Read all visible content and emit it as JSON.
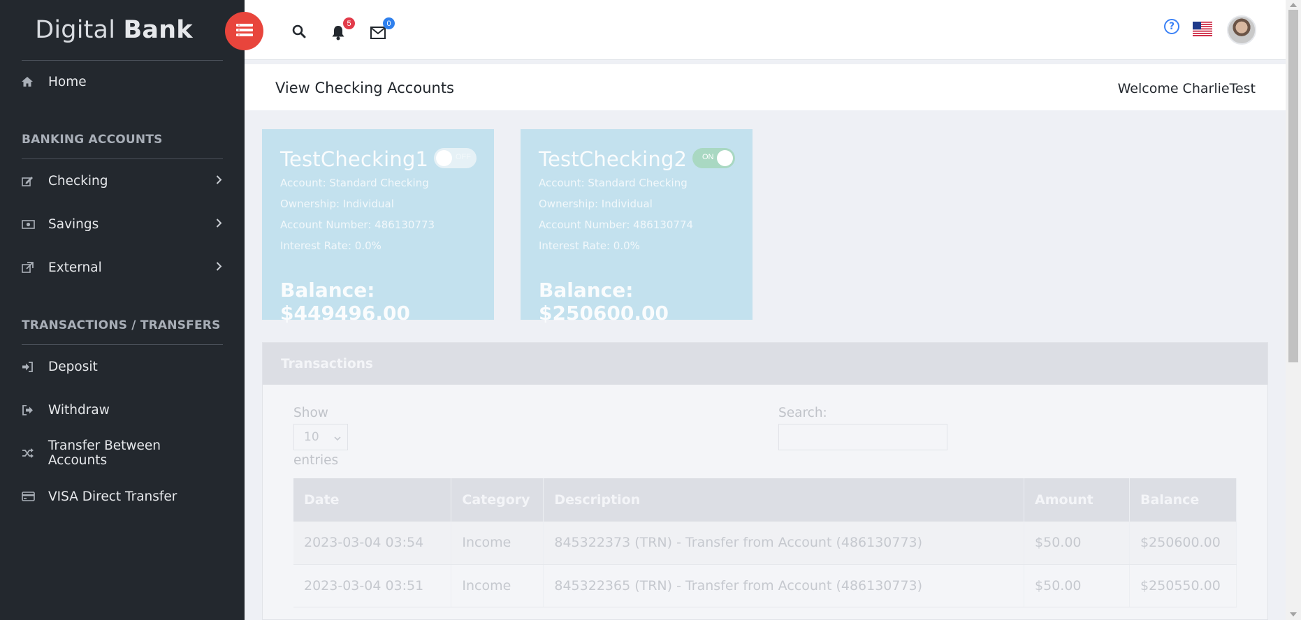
{
  "brand": {
    "light": "Digital ",
    "bold": "Bank"
  },
  "sidebar": {
    "home": "Home",
    "section_banking": "BANKING ACCOUNTS",
    "checking": "Checking",
    "savings": "Savings",
    "external": "External",
    "section_transactions": "TRANSACTIONS / TRANSFERS",
    "deposit": "Deposit",
    "withdraw": "Withdraw",
    "transfer": "Transfer Between Accounts",
    "visa": "VISA Direct Transfer"
  },
  "header": {
    "notifications_count": "5",
    "messages_count": "0",
    "help": "?",
    "icons": [
      "menu-icon",
      "search-icon",
      "bell-icon",
      "envelope-icon",
      "help-icon",
      "us-flag-icon",
      "user-avatar"
    ]
  },
  "page": {
    "title": "View Checking Accounts",
    "welcome": "Welcome CharlieTest"
  },
  "accounts": [
    {
      "name": "TestChecking1",
      "type": "Account: Standard Checking",
      "ownership": "Ownership: Individual",
      "number": "Account Number: 486130773",
      "rate": "Interest Rate: 0.0%",
      "balance": "Balance: $449496.00",
      "toggle_label": "OFF",
      "active": false
    },
    {
      "name": "TestChecking2",
      "type": "Account: Standard Checking",
      "ownership": "Ownership: Individual",
      "number": "Account Number: 486130774",
      "rate": "Interest Rate: 0.0%",
      "balance": "Balance: $250600.00",
      "toggle_label": "ON",
      "active": true
    }
  ],
  "transactions": {
    "title": "Transactions",
    "show_label": "Show",
    "page_length": "10",
    "entries_label": "entries",
    "search_label": "Search:",
    "search_value": "",
    "columns": [
      "Date",
      "Category",
      "Description",
      "Amount",
      "Balance"
    ],
    "rows": [
      [
        "2023-03-04 03:54",
        "Income",
        "845322373 (TRN) - Transfer from Account (486130773)",
        "$50.00",
        "$250600.00"
      ],
      [
        "2023-03-04 03:51",
        "Income",
        "845322365 (TRN) - Transfer from Account (486130773)",
        "$50.00",
        "$250550.00"
      ]
    ]
  },
  "colors": {
    "sidebar_bg": "#23282e",
    "accent_red": "#e8453c",
    "card_bg": "#c3e1ee",
    "badge_red": "#e23b4a",
    "badge_blue": "#2f80ed"
  }
}
